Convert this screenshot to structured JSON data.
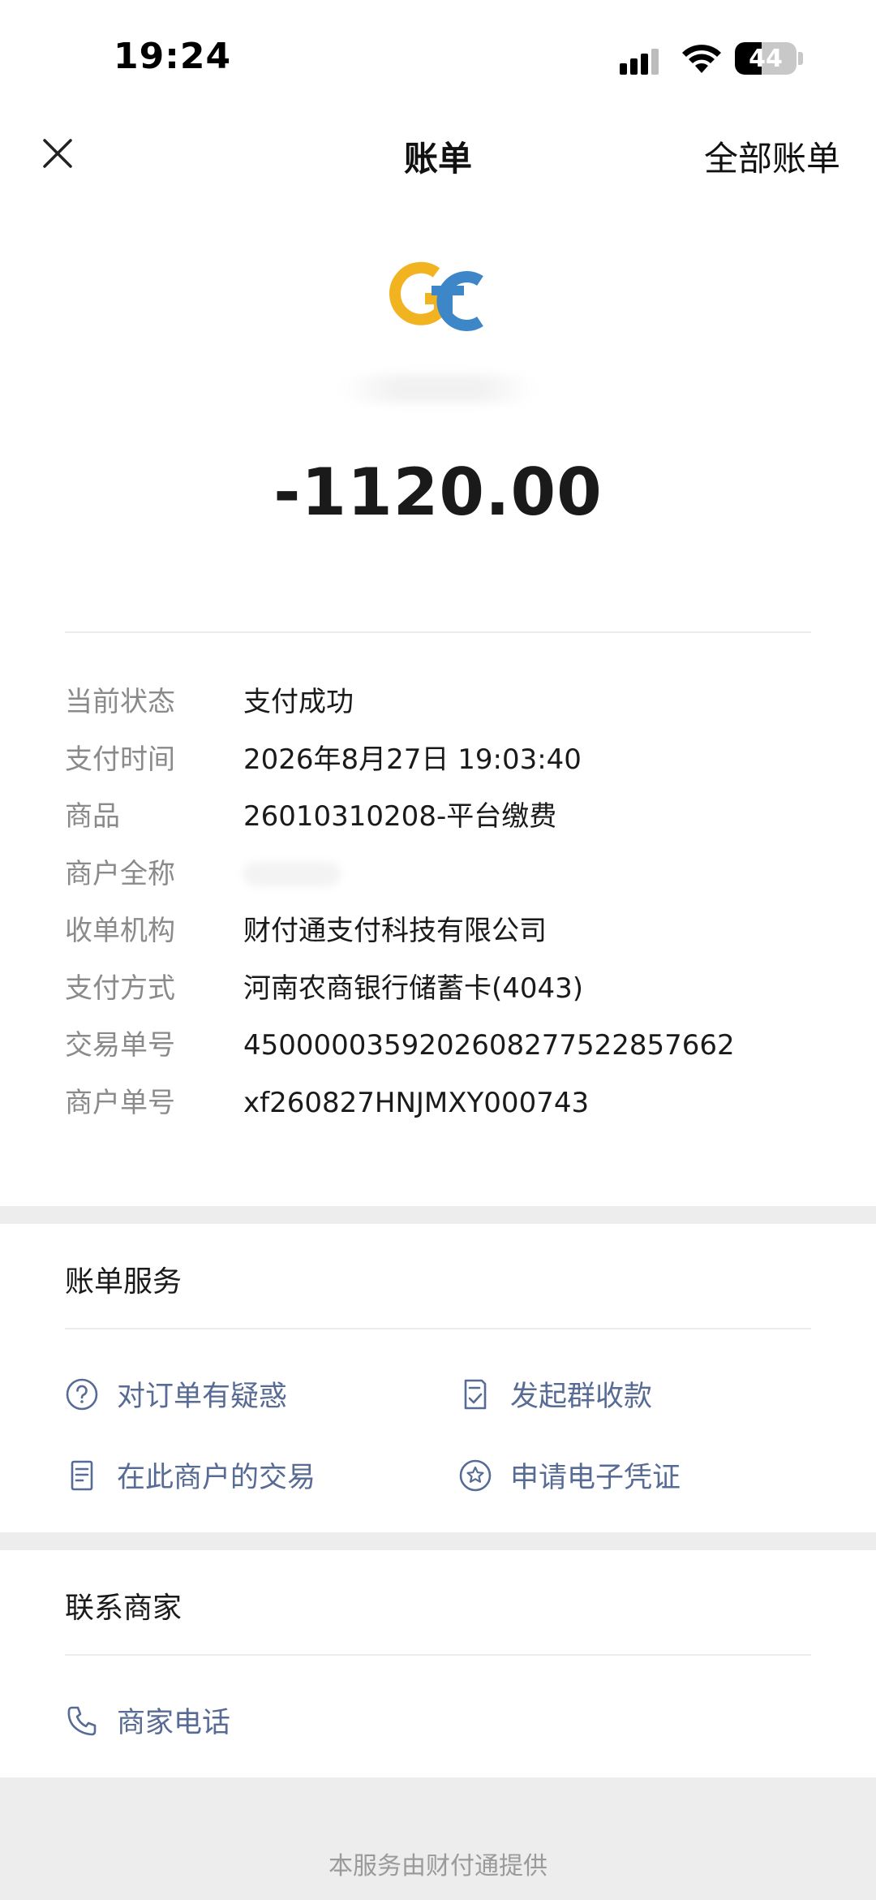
{
  "status_bar": {
    "time": "19:24",
    "battery": "44",
    "battery_level": 0.44
  },
  "header": {
    "title": "账单",
    "all_bills_label": "全部账单"
  },
  "amount": "-1120.00",
  "details": [
    {
      "label": "当前状态",
      "value": "支付成功"
    },
    {
      "label": "支付时间",
      "value": "2026年8月27日 19:03:40"
    },
    {
      "label": "商品",
      "value": "26010310208-平台缴费"
    },
    {
      "label": "商户全称",
      "value": ""
    },
    {
      "label": "收单机构",
      "value": "财付通支付科技有限公司"
    },
    {
      "label": "支付方式",
      "value": "河南农商银行储蓄卡(4043)"
    },
    {
      "label": "交易单号",
      "value": "4500000359202608277522857662"
    },
    {
      "label": "商户单号",
      "value": "xf260827HNJMXY000743"
    }
  ],
  "bill_services": {
    "title": "账单服务",
    "items": [
      {
        "icon": "question-icon",
        "label": "对订单有疑惑"
      },
      {
        "icon": "group-collect-icon",
        "label": "发起群收款"
      },
      {
        "icon": "document-icon",
        "label": "在此商户的交易"
      },
      {
        "icon": "star-badge-icon",
        "label": "申请电子凭证"
      }
    ]
  },
  "contact": {
    "title": "联系商家",
    "phone_label": "商家电话"
  },
  "footer": {
    "text": "本服务由财付通提供"
  },
  "colors": {
    "link": "#576b95",
    "logo_yellow": "#f2b321",
    "logo_blue": "#3d86c8"
  }
}
